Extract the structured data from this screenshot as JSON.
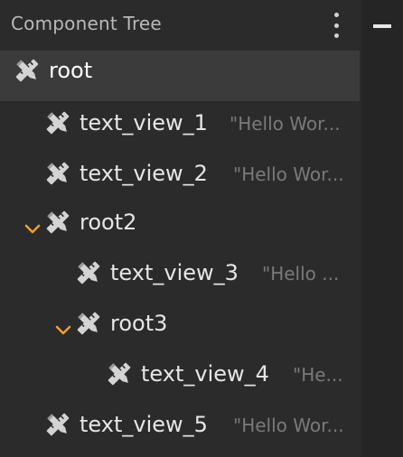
{
  "header": {
    "title": "Component Tree",
    "more_icon": "more-vertical-icon",
    "collapse_icon": "minimize-icon"
  },
  "colors": {
    "background": "#2b2b2b",
    "selected_row": "#3b3b3b",
    "side_strip": "#252525",
    "text": "#e6e6e6",
    "hint_text": "#7a7a7a",
    "chevron": "#f0a030"
  },
  "tree": {
    "items": [
      {
        "label": "root",
        "hint": "",
        "selected": true,
        "expandable": false,
        "icon": "view-component-icon"
      },
      {
        "label": "text_view_1",
        "hint": "\"Hello Wor...",
        "selected": false,
        "expandable": false,
        "icon": "view-component-icon"
      },
      {
        "label": "text_view_2",
        "hint": "\"Hello Wor...",
        "selected": false,
        "expandable": false,
        "icon": "view-component-icon"
      },
      {
        "label": "root2",
        "hint": "",
        "selected": false,
        "expandable": true,
        "expanded": true,
        "icon": "view-component-icon"
      },
      {
        "label": "text_view_3",
        "hint": "\"Hello ...",
        "selected": false,
        "expandable": false,
        "icon": "view-component-icon"
      },
      {
        "label": "root3",
        "hint": "",
        "selected": false,
        "expandable": true,
        "expanded": true,
        "icon": "view-component-icon"
      },
      {
        "label": "text_view_4",
        "hint": "\"He...",
        "selected": false,
        "expandable": false,
        "icon": "view-component-icon"
      },
      {
        "label": "text_view_5",
        "hint": "\"Hello Wor...",
        "selected": false,
        "expandable": false,
        "icon": "view-component-icon"
      }
    ]
  }
}
